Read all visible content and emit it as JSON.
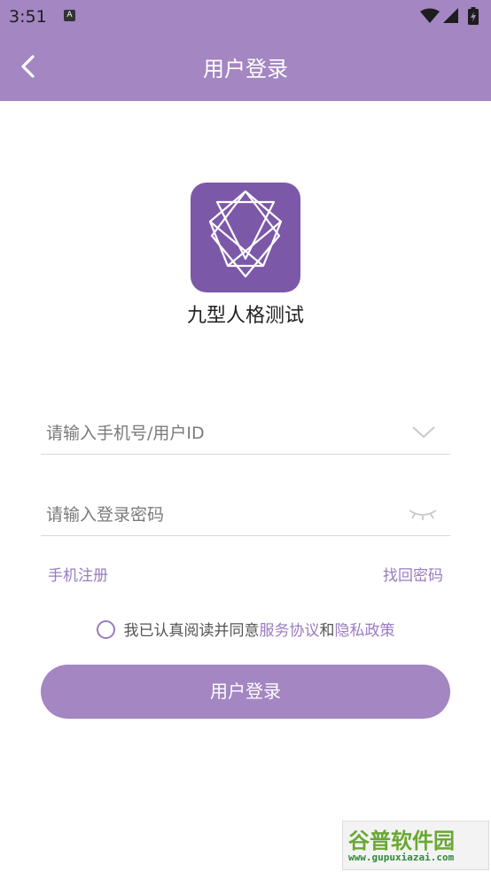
{
  "status_bar": {
    "time": "3:51",
    "notification_icon": "A"
  },
  "app_bar": {
    "title": "用户登录",
    "back_icon": "chevron-left-icon"
  },
  "app": {
    "name": "九型人格测试",
    "logo_icon": "enneagram-icon",
    "logo_color": "#7c58a8"
  },
  "form": {
    "phone_placeholder": "请输入手机号/用户ID",
    "password_placeholder": "请输入登录密码",
    "register_label": "手机注册",
    "forgot_label": "找回密码"
  },
  "agreement": {
    "prefix": "我已认真阅读并同意",
    "terms": "服务协议",
    "and": "和",
    "privacy": "隐私政策",
    "checked": false
  },
  "login_button": "用户登录",
  "watermark": {
    "line1": "谷普软件园",
    "line2": "www.gupuxiazai.com"
  },
  "colors": {
    "accent": "#a386c2",
    "link": "#9a7cc0",
    "divider": "#d8d8d8"
  }
}
